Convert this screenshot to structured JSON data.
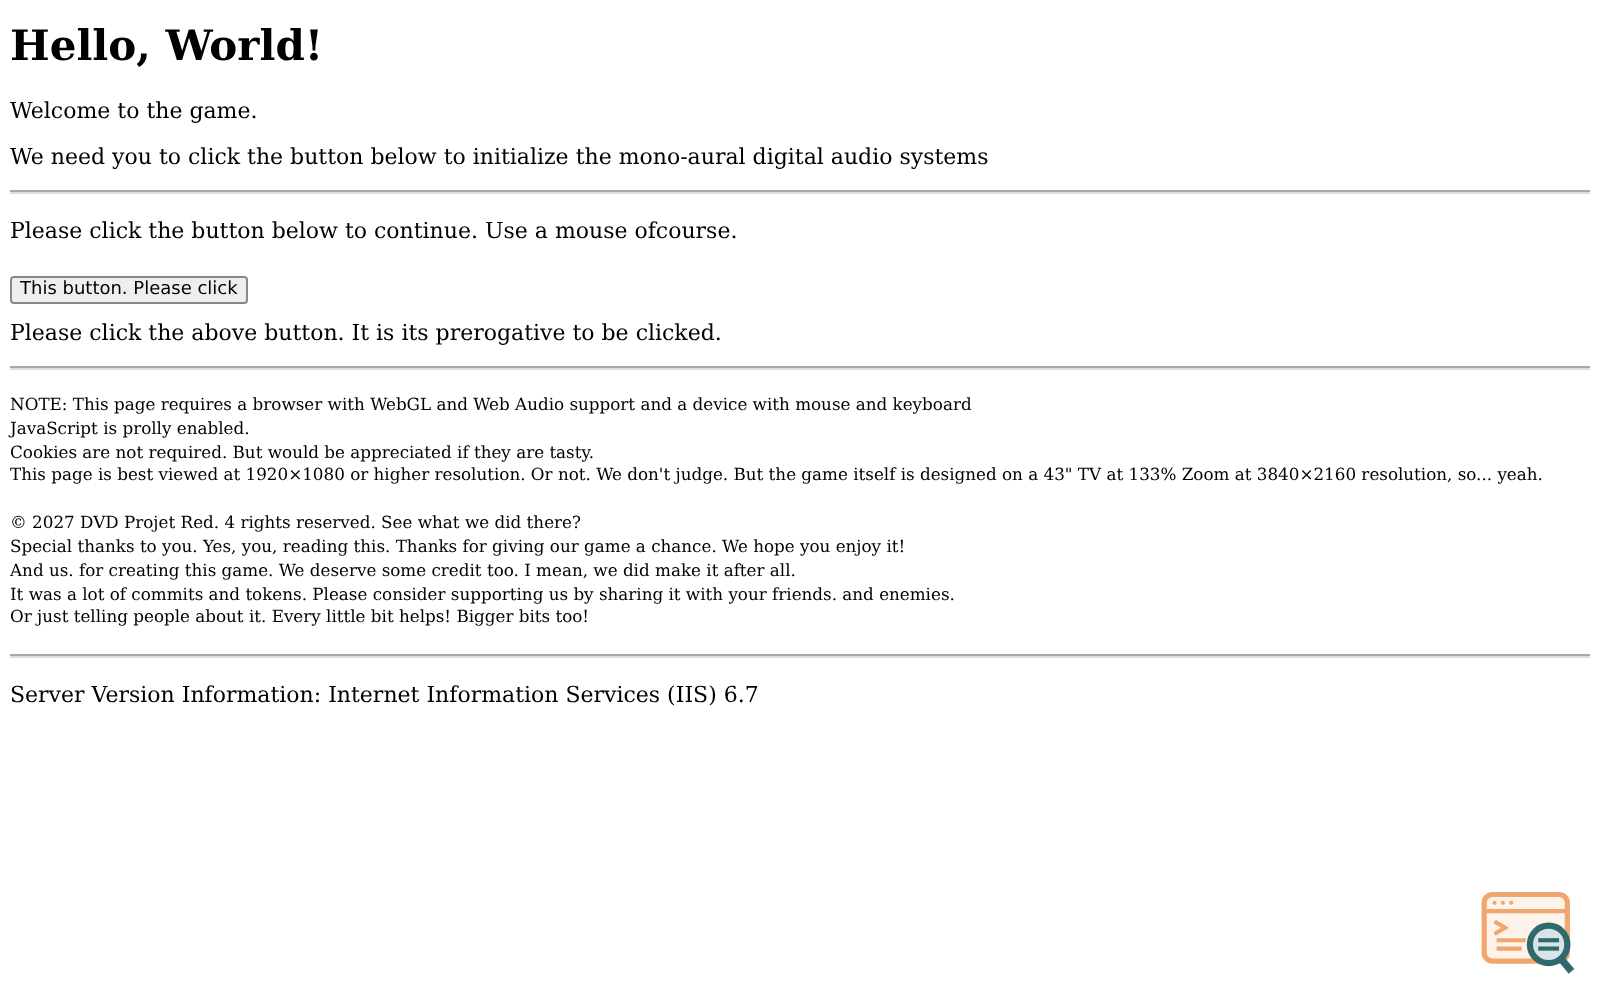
{
  "heading": "Hello, World!",
  "intro": [
    "Welcome to the game.",
    "We need you to click the button below to initialize the mono-aural digital audio systems"
  ],
  "prompt": "Please click the button below to continue. Use a mouse ofcourse.",
  "button": "This button. Please click",
  "after": "Please click the above button. It is its prerogative to be clicked.",
  "notes": [
    "NOTE: This page requires a browser with WebGL and Web Audio support and a device with mouse and keyboard",
    "JavaScript is prolly enabled.",
    "Cookies are not required. But would be appreciated if they are tasty.",
    "This page is best viewed at 1920×1080 or higher resolution. Or not. We don't judge. But the game itself is designed on a 43\" TV at 133% Zoom at 3840×2160 resolution, so... yeah."
  ],
  "credits": [
    "© 2027 DVD Projet Red. 4 rights reserved. See what we did there?",
    "Special thanks to you. Yes, you, reading this. Thanks for giving our game a chance. We hope you enjoy it!",
    "And us. for creating this game. We deserve some credit too. I mean, we did make it after all.",
    "It was a lot of commits and tokens. Please consider supporting us by sharing it with your friends. and enemies.",
    "Or just telling people about it. Every little bit helps! Bigger bits too!"
  ],
  "server": "Server Version Information: Internet Information Services (IIS) 6.7"
}
